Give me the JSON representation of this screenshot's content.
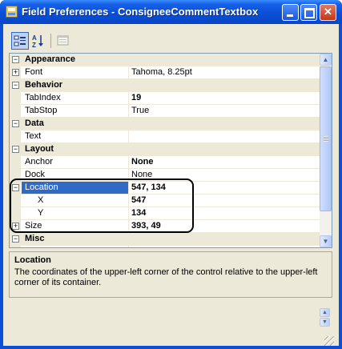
{
  "window": {
    "title": "Field Preferences - ConsigneeCommentTextbox",
    "controls": {
      "minimize": "minimize",
      "maximize": "maximize",
      "close": "✕"
    }
  },
  "toolbar": {
    "buttons": [
      {
        "icon": "categorized-icon",
        "pressed": true
      },
      {
        "icon": "alphabetical-sort-icon",
        "pressed": false
      },
      {
        "icon": "property-pages-icon",
        "pressed": false
      }
    ]
  },
  "grid": {
    "rows": [
      {
        "type": "category",
        "name": "Appearance",
        "expander": "−"
      },
      {
        "type": "property",
        "name": "Font",
        "value": "Tahoma, 8.25pt",
        "expander": "+"
      },
      {
        "type": "category",
        "name": "Behavior",
        "expander": "−"
      },
      {
        "type": "property",
        "name": "TabIndex",
        "value": "19",
        "bold": true
      },
      {
        "type": "property",
        "name": "TabStop",
        "value": "True"
      },
      {
        "type": "category",
        "name": "Data",
        "expander": "−"
      },
      {
        "type": "property",
        "name": "Text",
        "value": ""
      },
      {
        "type": "category",
        "name": "Layout",
        "expander": "−"
      },
      {
        "type": "property",
        "name": "Anchor",
        "value": "None",
        "bold": true
      },
      {
        "type": "property",
        "name": "Dock",
        "value": "None"
      },
      {
        "type": "property",
        "name": "Location",
        "value": "547, 134",
        "bold": true,
        "expander": "−",
        "selected": true
      },
      {
        "type": "subproperty",
        "name": "X",
        "value": "547",
        "bold": true
      },
      {
        "type": "subproperty",
        "name": "Y",
        "value": "134",
        "bold": true
      },
      {
        "type": "property",
        "name": "Size",
        "value": "393, 49",
        "bold": true,
        "expander": "+"
      },
      {
        "type": "category",
        "name": "Misc",
        "expander": "−"
      },
      {
        "type": "property",
        "name": "",
        "value": ""
      }
    ],
    "scrollbar": {
      "up": "▲",
      "down": "▼"
    }
  },
  "help": {
    "title": "Location",
    "description": "The coordinates of the upper-left corner of the control relative to the upper-left corner of its container."
  },
  "bottom_scroll": {
    "up": "▲",
    "down": "▼"
  },
  "colors": {
    "titlebar": "#0a4fd6",
    "selection": "#316ac5",
    "category_bg": "#ece9d8",
    "grid_border": "#7f9db9"
  }
}
